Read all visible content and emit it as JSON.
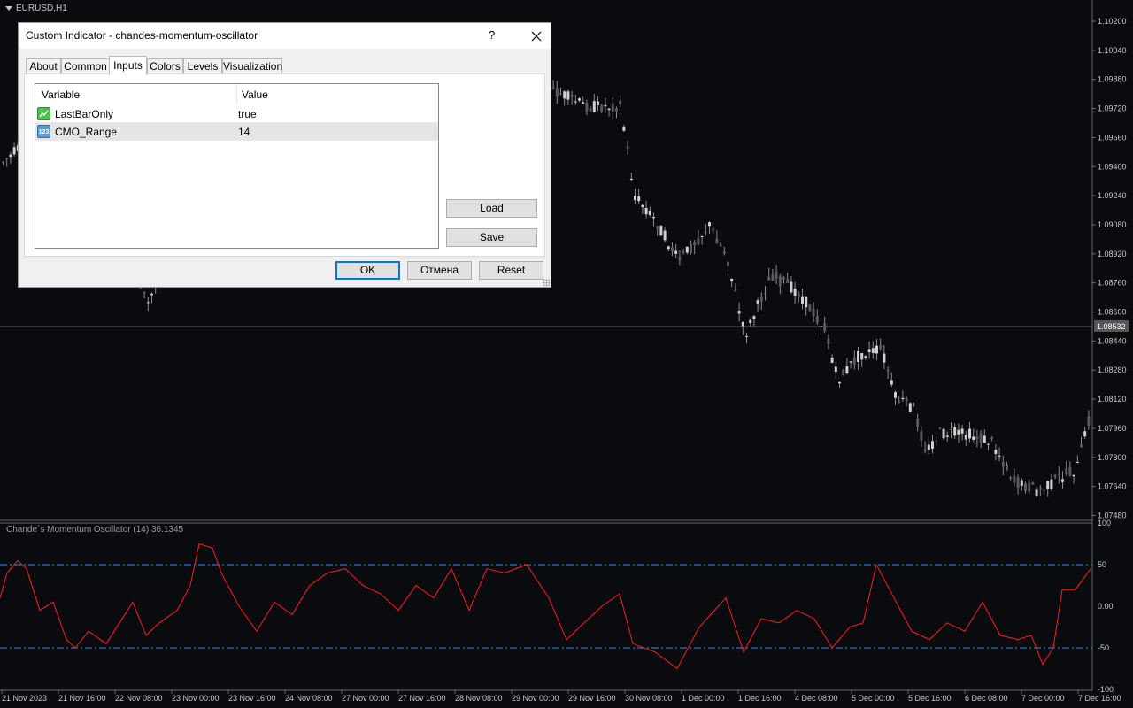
{
  "chart": {
    "symbol_label": "EURUSD,H1",
    "price_labels": [
      "1.10200",
      "1.10040",
      "1.09880",
      "1.09720",
      "1.09560",
      "1.09400",
      "1.09240",
      "1.09080",
      "1.08920",
      "1.08760",
      "1.08600",
      "1.08440",
      "1.08280",
      "1.08120",
      "1.07960",
      "1.07800",
      "1.07640",
      "1.07480"
    ],
    "current_price": "1.08532",
    "indicator_label": "Chande`s Momentum Oscillator (14) 36.1345",
    "indicator_axis_labels": [
      "100",
      "50",
      "0.00",
      "-50",
      "-100"
    ],
    "indicator_levels": [
      50,
      -50
    ],
    "time_labels": [
      "21 Nov 2023",
      "21 Nov 16:00",
      "22 Nov 08:00",
      "23 Nov 00:00",
      "23 Nov 16:00",
      "24 Nov 08:00",
      "27 Nov 00:00",
      "27 Nov 16:00",
      "28 Nov 08:00",
      "29 Nov 00:00",
      "29 Nov 16:00",
      "30 Nov 08:00",
      "1 Dec 00:00",
      "1 Dec 16:00",
      "4 Dec 08:00",
      "5 Dec 00:00",
      "5 Dec 16:00",
      "6 Dec 08:00",
      "7 Dec 00:00",
      "7 Dec 16:00"
    ],
    "colors": {
      "background": "#0a0b0f",
      "candles": "#8c8c8c",
      "oscillator": "#ff1a1a",
      "levels": "#1e90ff",
      "axis_text": "#c8c8c8"
    }
  },
  "dialog": {
    "title": "Custom Indicator - chandes-momentum-oscillator",
    "help": "?",
    "tabs": [
      "About",
      "Common",
      "Inputs",
      "Colors",
      "Levels",
      "Visualization"
    ],
    "active_tab": "Inputs",
    "table": {
      "headers": [
        "Variable",
        "Value"
      ],
      "rows": [
        {
          "icon": "bool-icon",
          "name": "LastBarOnly",
          "value": "true"
        },
        {
          "icon": "int-icon",
          "icon_text": "123",
          "name": "CMO_Range",
          "value": "14"
        }
      ]
    },
    "buttons": {
      "load": "Load",
      "save": "Save",
      "ok": "OK",
      "cancel": "Отмена",
      "reset": "Reset"
    }
  }
}
